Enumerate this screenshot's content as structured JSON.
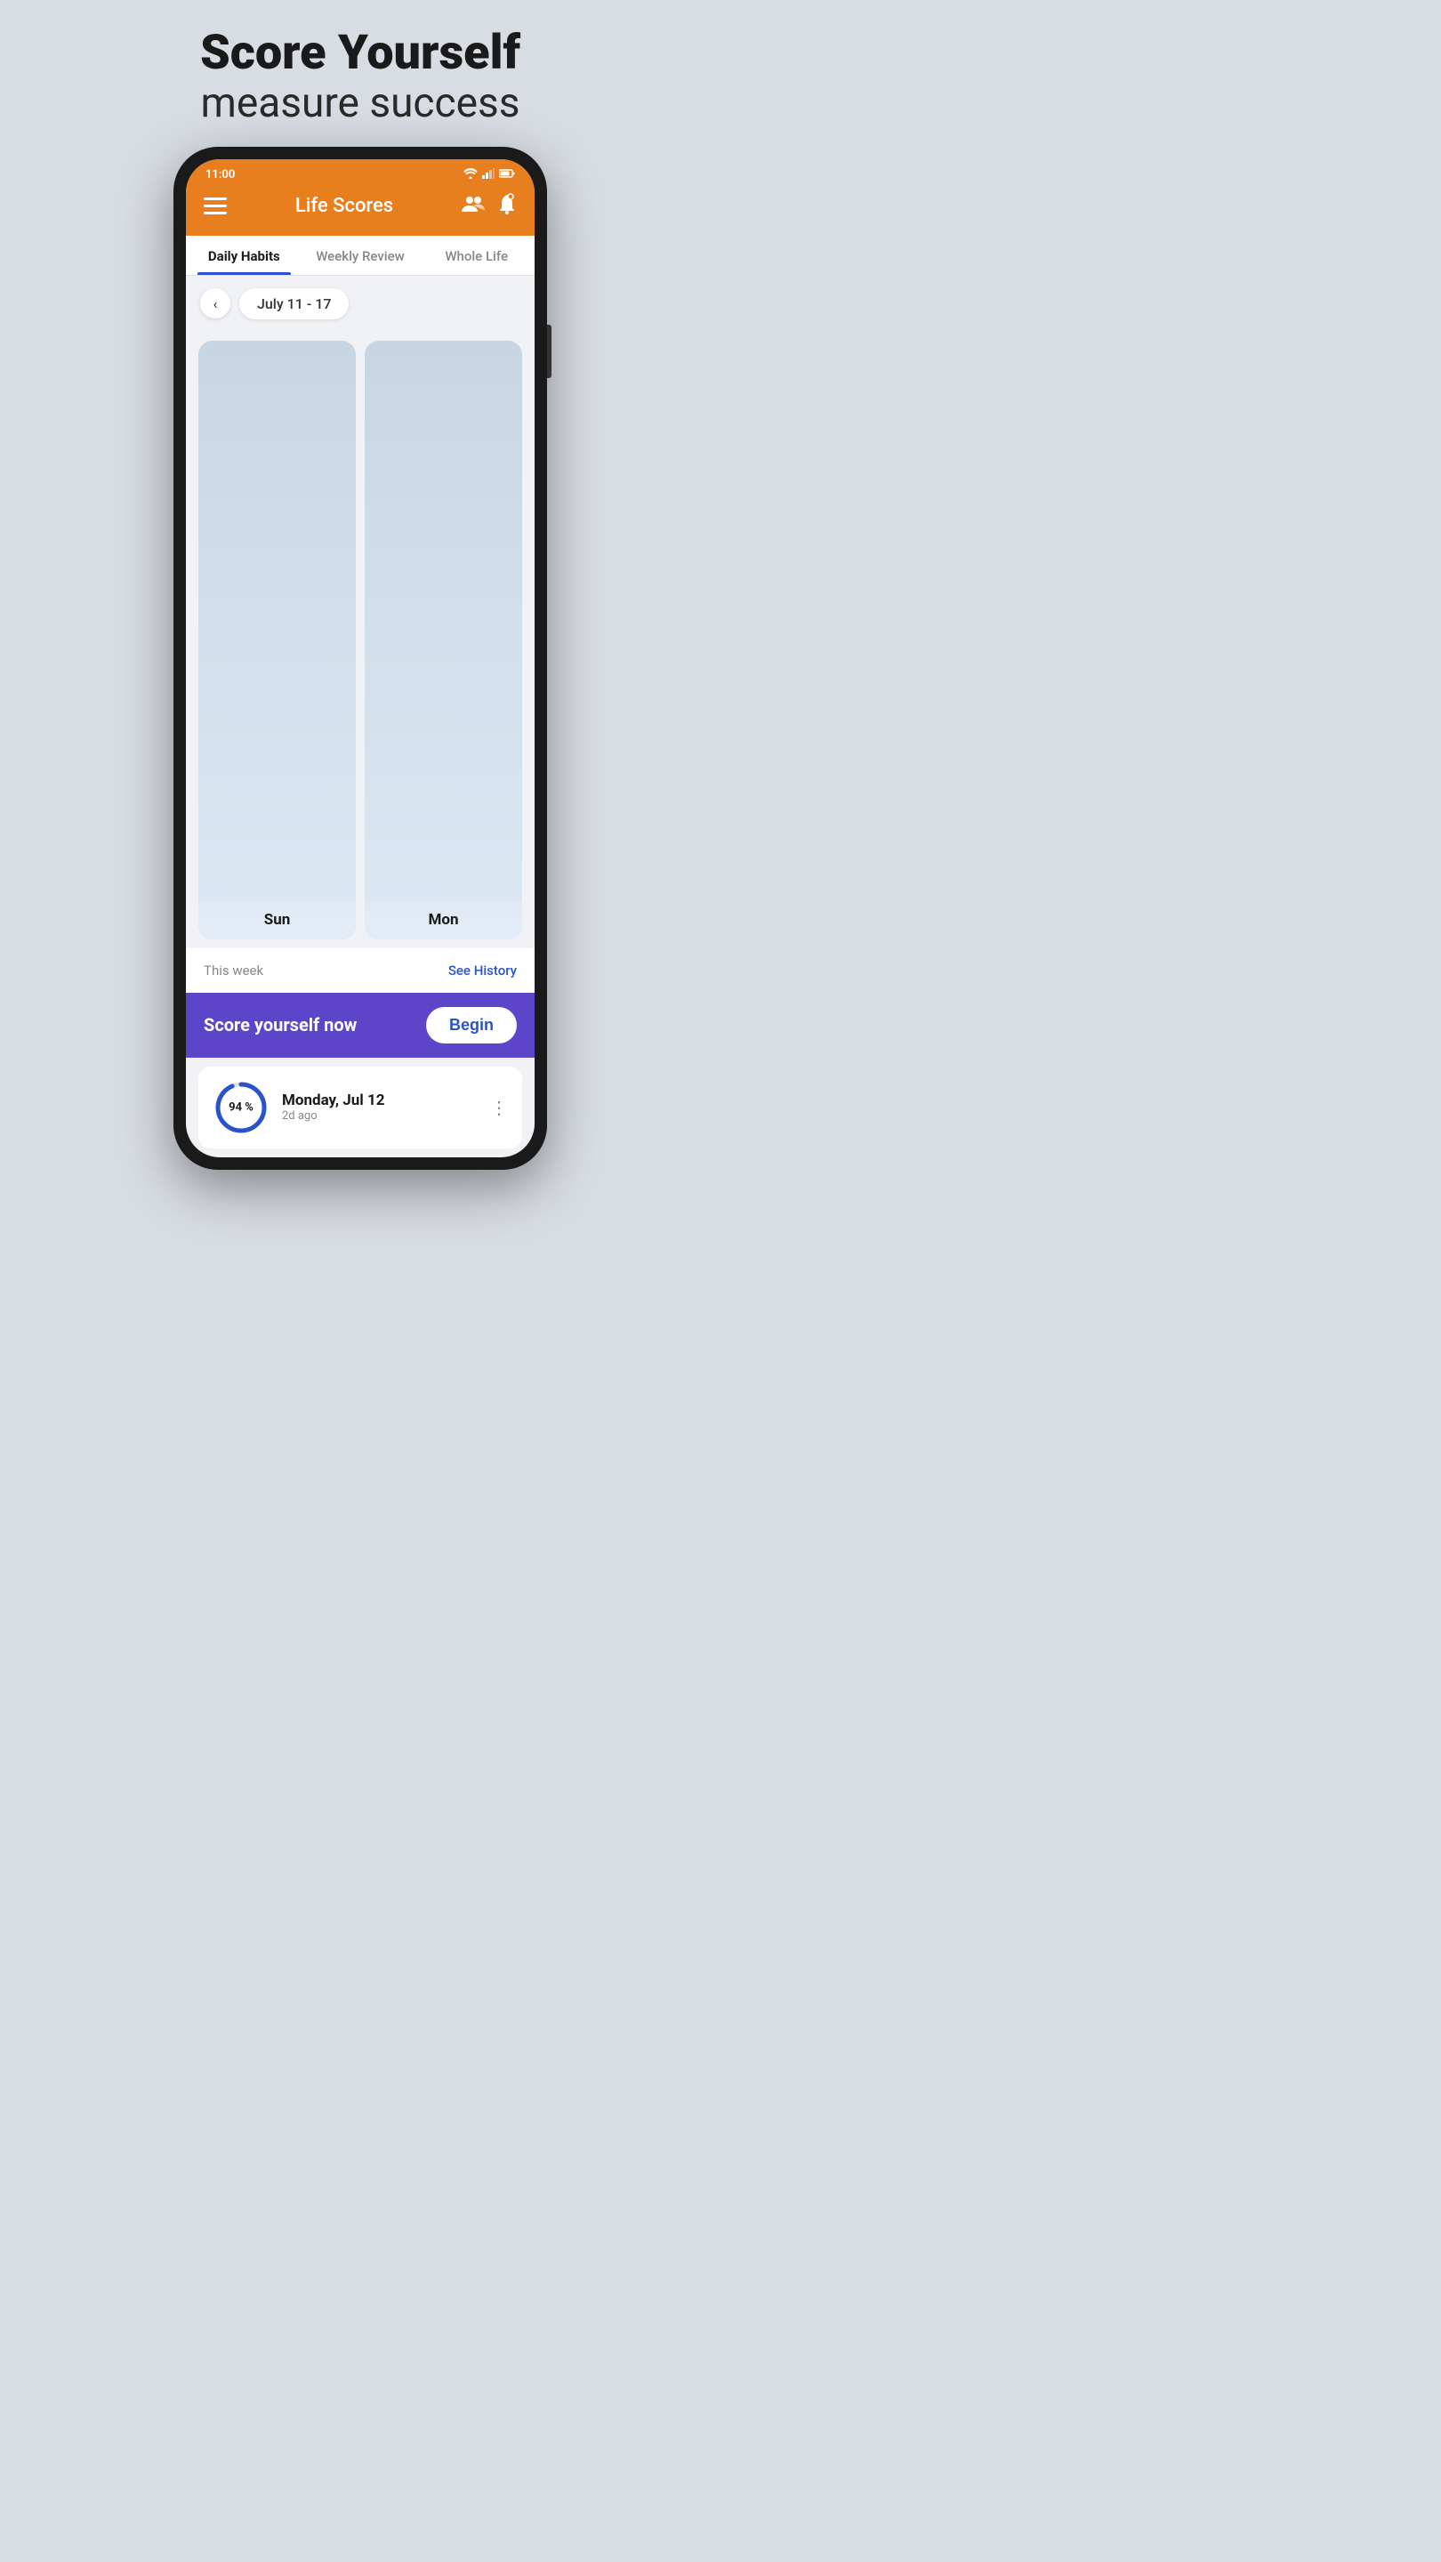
{
  "headline": {
    "bold": "Score Yourself",
    "sub": "measure success"
  },
  "status_bar": {
    "time": "11:00",
    "wifi": "wifi",
    "signal": "signal",
    "battery": "battery"
  },
  "top_bar": {
    "title": "Life Scores",
    "menu_icon": "menu",
    "people_icon": "people",
    "bell_icon": "bell"
  },
  "tabs": [
    {
      "label": "Daily Habits",
      "active": true
    },
    {
      "label": "Weekly Review",
      "active": false
    },
    {
      "label": "Whole Life",
      "active": false
    }
  ],
  "date_nav": {
    "back_arrow": "‹",
    "date_range": "July 11 - 17"
  },
  "day_cards": [
    {
      "label": "Sun"
    },
    {
      "label": "Mon"
    }
  ],
  "week_section": {
    "label": "This week",
    "see_history": "See History"
  },
  "cta_banner": {
    "text": "Score yourself now",
    "button_label": "Begin"
  },
  "history_entry": {
    "percentage": "94 %",
    "date": "Monday, Jul 12",
    "ago": "2d ago"
  }
}
